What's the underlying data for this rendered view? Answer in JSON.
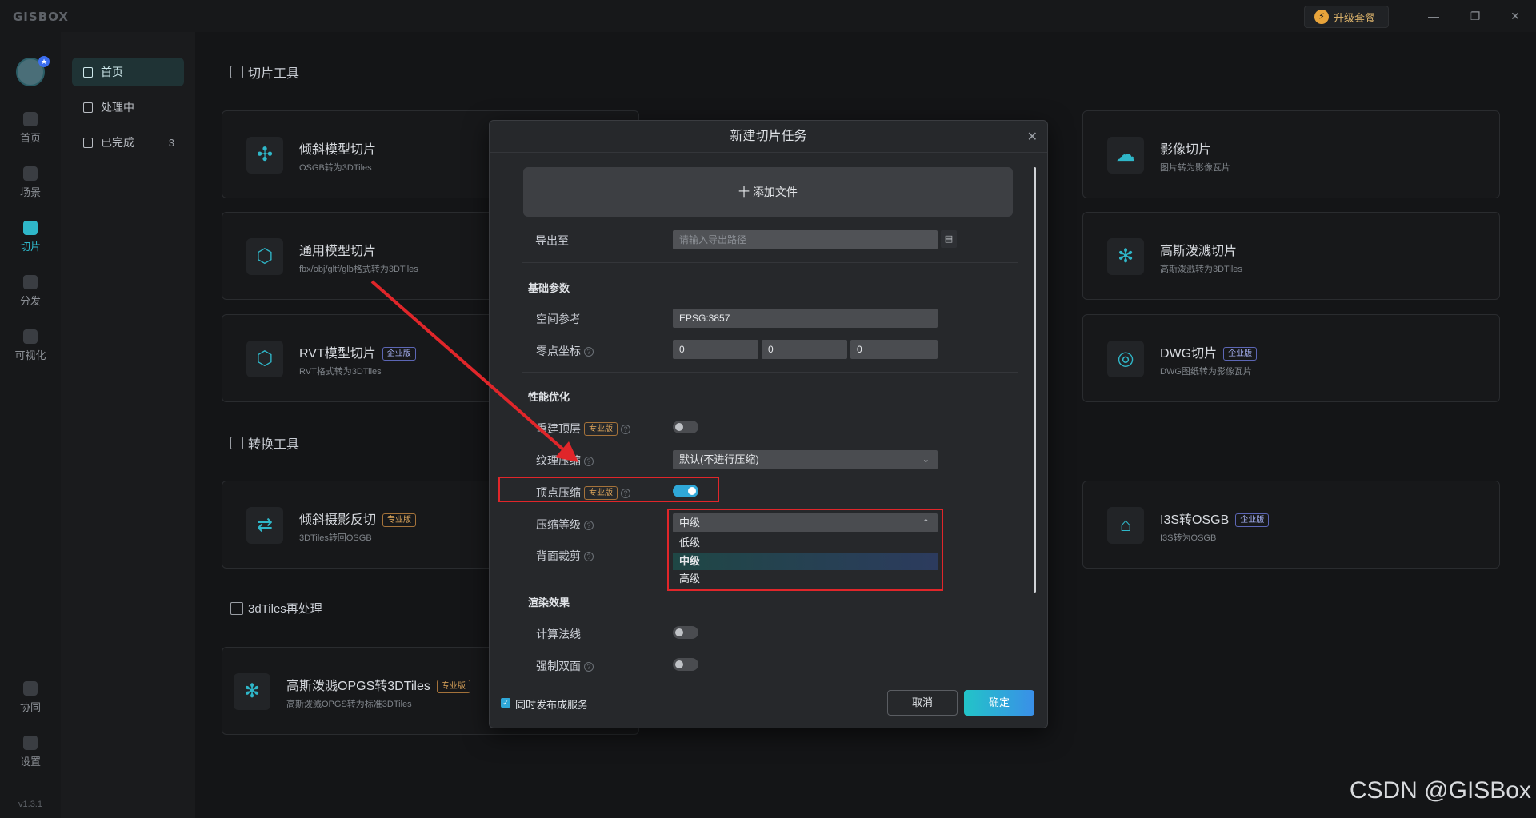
{
  "app": {
    "logo": "GISBOX",
    "upgrade": "升级套餐",
    "version": "v1.3.1"
  },
  "leftnav": [
    {
      "label": "首页",
      "icon": "home-icon"
    },
    {
      "label": "场景",
      "icon": "cube-icon"
    },
    {
      "label": "切片",
      "icon": "slice-icon"
    },
    {
      "label": "分发",
      "icon": "share-icon"
    },
    {
      "label": "可视化",
      "icon": "visual-icon"
    },
    {
      "label": "协同",
      "icon": "lock-icon"
    },
    {
      "label": "设置",
      "icon": "gear-icon"
    }
  ],
  "subnav": [
    {
      "label": "首页"
    },
    {
      "label": "处理中"
    },
    {
      "label": "已完成",
      "count": "3"
    }
  ],
  "sections": {
    "slice": "切片工具",
    "convert": "转换工具",
    "reprocess": "3dTiles再处理"
  },
  "cards": {
    "oblique": {
      "title": "倾斜模型切片",
      "sub": "OSGB转为3DTiles"
    },
    "generic": {
      "title": "通用模型切片",
      "sub": "fbx/obj/gltf/glb格式转为3DTiles"
    },
    "rvt": {
      "title": "RVT模型切片",
      "badge": "企业版",
      "sub": "RVT格式转为3DTiles"
    },
    "image": {
      "title": "影像切片",
      "sub": "图片转为影像瓦片"
    },
    "gauss": {
      "title": "高斯泼溅切片",
      "sub": "高斯泼溅转为3DTiles"
    },
    "dwg": {
      "title": "DWG切片",
      "badge": "企业版",
      "sub": "DWG图纸转为影像瓦片"
    },
    "reverse": {
      "title": "倾斜摄影反切",
      "badge": "专业版",
      "sub": "3DTiles转回OSGB"
    },
    "i3s": {
      "title": "I3S转OSGB",
      "badge": "企业版",
      "sub": "I3S转为OSGB"
    },
    "opgs": {
      "title": "高斯泼溅OPGS转3DTiles",
      "badge": "专业版",
      "sub": "高斯泼溅OPGS转为标准3DTiles"
    }
  },
  "dialog": {
    "title": "新建切片任务",
    "add_file": "十 添加文件",
    "export_label": "导出至",
    "export_placeholder": "请输入导出路径",
    "basic_title": "基础参数",
    "srs_label": "空间参考",
    "srs_value": "EPSG:3857",
    "origin_label": "零点坐标",
    "origin_x": "0",
    "origin_y": "0",
    "origin_z": "0",
    "perf_title": "性能优化",
    "rebuild_label": "重建顶层",
    "pro_badge": "专业版",
    "texture_label": "纹理压缩",
    "texture_value": "默认(不进行压缩)",
    "vertex_label": "顶点压缩",
    "level_label": "压缩等级",
    "level_value": "中级",
    "level_options": [
      "低级",
      "中级",
      "高级"
    ],
    "backface_label": "背面裁剪",
    "render_title": "渲染效果",
    "normal_label": "计算法线",
    "doubleside_label": "强制双面",
    "publish_label": "同时发布成服务",
    "cancel": "取消",
    "ok": "确定"
  },
  "watermark": "CSDN @GISBox",
  "colors": {
    "accent": "#2fb7c9",
    "highlight": "#e0262a"
  }
}
